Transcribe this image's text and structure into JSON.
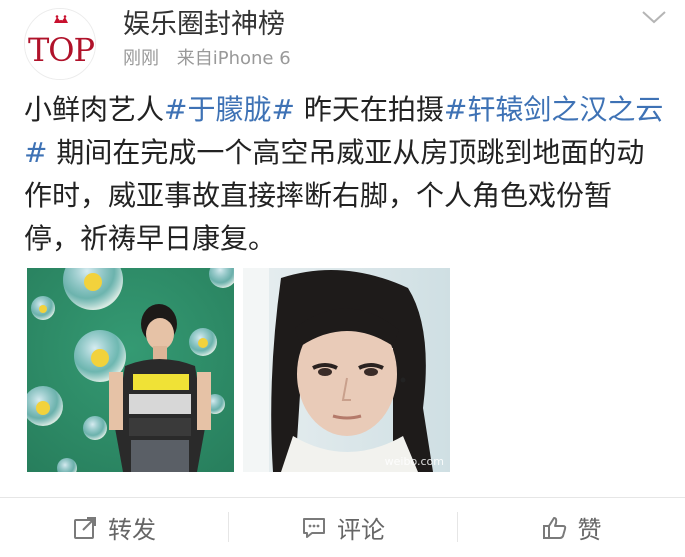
{
  "post": {
    "author": "娱乐圈封神榜",
    "time": "刚刚",
    "source": "来自iPhone 6",
    "avatar_text": "TOP",
    "text_segments": [
      {
        "text": "小鲜肉艺人",
        "type": "plain"
      },
      {
        "text": "#于朦胧#",
        "type": "hashtag"
      },
      {
        "text": " 昨天在拍摄",
        "type": "plain"
      },
      {
        "text": "#轩辕剑之汉之云#",
        "type": "hashtag"
      },
      {
        "text": " 期间在完成一个高空吊威亚从房顶跳到地面的动作时，威亚事故直接摔断右脚，个人角色戏份暂停，祈祷早日康复。",
        "type": "plain"
      }
    ],
    "images": [
      {
        "icon": "photo-sponge-bubbles"
      },
      {
        "icon": "photo-costume-portrait",
        "watermark": "weibo.com"
      }
    ]
  },
  "actions": {
    "repost_label": "转发",
    "comment_label": "评论",
    "like_label": "赞"
  },
  "colors": {
    "hashtag": "#3e72b5",
    "meta": "#999999",
    "crown": "#c8102e"
  }
}
